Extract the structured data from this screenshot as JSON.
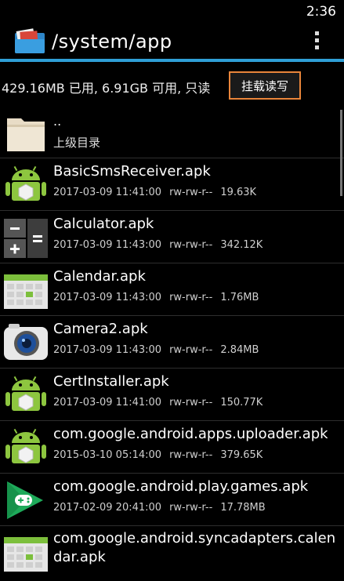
{
  "status": {
    "time": "2:36"
  },
  "header": {
    "title": "/system/app"
  },
  "storage": {
    "info": "429.16MB 已用, 6.91GB 可用, 只读",
    "mount_label": "挂载读写"
  },
  "parent": {
    "name": "..",
    "label": "上级目录"
  },
  "files": [
    {
      "name": "BasicSmsReceiver.apk",
      "date": "2017-03-09 11:41:00",
      "perm": "rw-rw-r--",
      "size": "19.63K",
      "icon": "android-robot-icon"
    },
    {
      "name": "Calculator.apk",
      "date": "2017-03-09 11:43:00",
      "perm": "rw-rw-r--",
      "size": "342.12K",
      "icon": "calculator-icon"
    },
    {
      "name": "Calendar.apk",
      "date": "2017-03-09 11:43:00",
      "perm": "rw-rw-r--",
      "size": "1.76MB",
      "icon": "calendar-icon"
    },
    {
      "name": "Camera2.apk",
      "date": "2017-03-09 11:43:00",
      "perm": "rw-rw-r--",
      "size": "2.84MB",
      "icon": "camera-icon"
    },
    {
      "name": "CertInstaller.apk",
      "date": "2017-03-09 11:41:00",
      "perm": "rw-rw-r--",
      "size": "150.77K",
      "icon": "android-robot-icon"
    },
    {
      "name": "com.google.android.apps.uploader.apk",
      "date": "2015-03-10 05:14:00",
      "perm": "rw-rw-r--",
      "size": "379.65K",
      "icon": "android-robot-icon"
    },
    {
      "name": "com.google.android.play.games.apk",
      "date": "2017-02-09 20:41:00",
      "perm": "rw-rw-r--",
      "size": "17.78MB",
      "icon": "play-games-icon"
    },
    {
      "name": "com.google.android.syncadapters.calendar.apk",
      "icon": "calendar-icon"
    }
  ],
  "colors": {
    "accent": "#2f9fd6",
    "button_border": "#e9853a",
    "android_green": "#8dc63f"
  }
}
